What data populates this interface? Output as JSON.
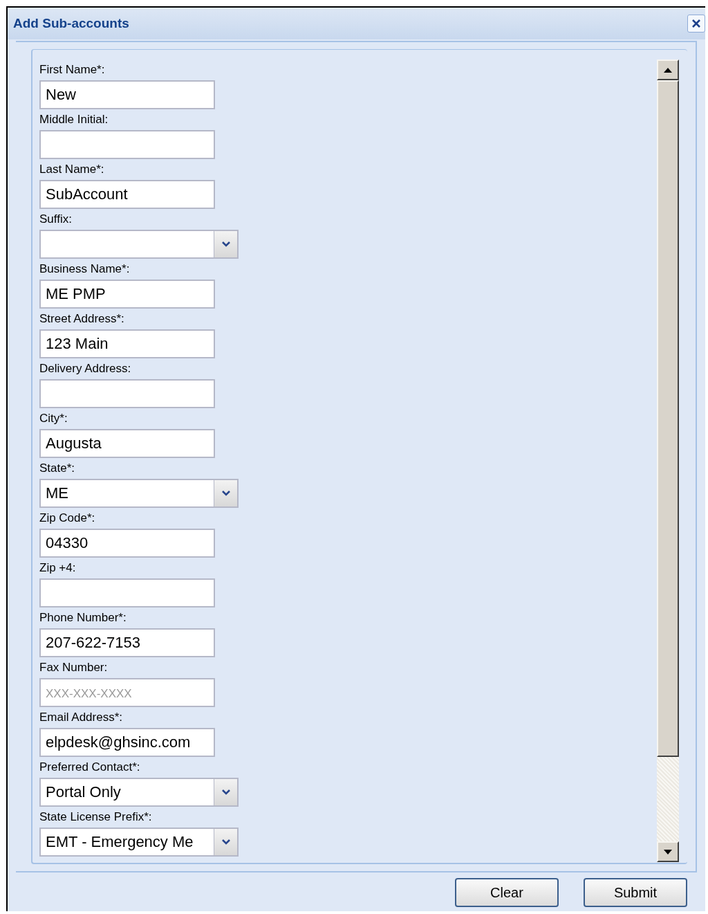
{
  "window": {
    "title": "Add Sub-accounts"
  },
  "fields": [
    {
      "label": "First Name*:",
      "kind": "text",
      "value": "New"
    },
    {
      "label": "Middle Initial:",
      "kind": "text"
    },
    {
      "label": "Last Name*:",
      "kind": "text",
      "value": "SubAccount"
    },
    {
      "label": "Suffix:",
      "kind": "select"
    },
    {
      "label": "Business Name*:",
      "kind": "text",
      "value": "ME PMP"
    },
    {
      "label": "Street Address*:",
      "kind": "text",
      "value": "123 Main"
    },
    {
      "label": "Delivery Address:",
      "kind": "text"
    },
    {
      "label": "City*:",
      "kind": "text",
      "value": "Augusta"
    },
    {
      "label": "State*:",
      "kind": "select",
      "value": "ME"
    },
    {
      "label": "Zip Code*:",
      "kind": "text",
      "value": "04330"
    },
    {
      "label": "Zip +4:",
      "kind": "text"
    },
    {
      "label": "Phone Number*:",
      "kind": "text",
      "value": "207-622-7153"
    },
    {
      "label": "Fax Number:",
      "kind": "text",
      "placeholder": "XXX-XXX-XXXX"
    },
    {
      "label": "Email Address*:",
      "kind": "text",
      "value": "elpdesk@ghsinc.com"
    },
    {
      "label": "Preferred Contact*:",
      "kind": "select",
      "value": "Portal Only"
    },
    {
      "label": "State License Prefix*:",
      "kind": "select",
      "value": "EMT - Emergency Me"
    }
  ],
  "buttons": [
    "Clear",
    "Submit"
  ]
}
